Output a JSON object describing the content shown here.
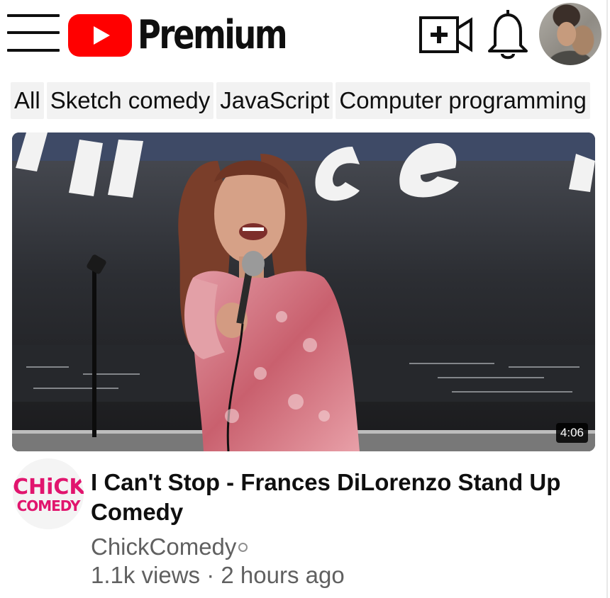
{
  "header": {
    "logo_text": "Premium",
    "icons": {
      "menu": "hamburger-menu-icon",
      "logo": "youtube-play-logo",
      "create": "video-camera-plus-icon",
      "notifications": "bell-icon",
      "avatar": "user-avatar"
    }
  },
  "chips": [
    {
      "label": "All"
    },
    {
      "label": "Sketch comedy"
    },
    {
      "label": "JavaScript"
    },
    {
      "label": "Computer programming"
    }
  ],
  "video": {
    "duration": "4:06",
    "title": "I Can't Stop - Frances DiLorenzo Stand Up Comedy",
    "channel": "ChickComedy",
    "views": "1.1k views",
    "separator": "·",
    "age": "2 hours ago",
    "channel_avatar": {
      "line1": "CHiCK",
      "line2": "COMEDY"
    }
  },
  "colors": {
    "brand_red": "#ff0000",
    "chip_bg": "#f2f2f2",
    "secondary_text": "#606060",
    "channel_pink": "#e1156e"
  }
}
